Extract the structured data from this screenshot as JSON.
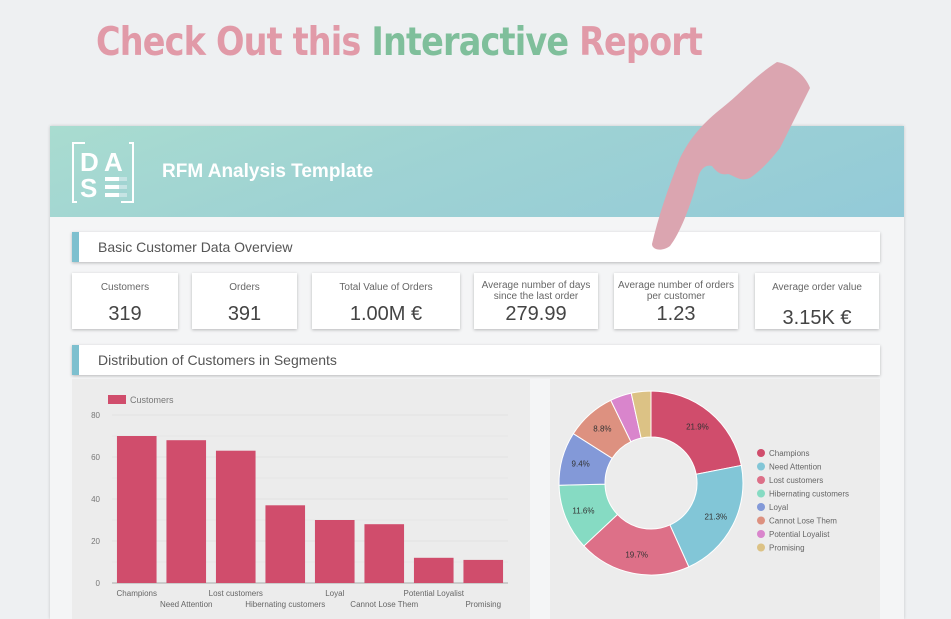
{
  "promo": {
    "part1": "Check Out this ",
    "part2": "Interactive",
    "part3": " Report",
    "pink": "#e19aa8",
    "green": "#7fbf9b"
  },
  "report": {
    "logo_letters": [
      "D",
      "A",
      "S",
      "E"
    ],
    "title": "RFM Analysis Template",
    "section1": "Basic Customer Data Overview",
    "section2": "Distribution of Customers in Segments"
  },
  "kpis": [
    {
      "label": "Customers",
      "value": "319"
    },
    {
      "label": "Orders",
      "value": "391"
    },
    {
      "label": "Total Value of Orders",
      "value": "1.00M €"
    },
    {
      "label": "Average number of days since the last order",
      "label_lines": [
        "Average number of days",
        "since the last order"
      ],
      "value": "279.99"
    },
    {
      "label": "Average number of orders per customer",
      "label_lines": [
        "Average number of orders",
        "per customer"
      ],
      "value": "1.23"
    },
    {
      "label": "Average order value",
      "value": "3.15K €"
    }
  ],
  "chart_data": [
    {
      "type": "bar",
      "title": "",
      "legend": [
        "Customers"
      ],
      "legend_position": "top-left",
      "categories": [
        "Champions",
        "Need Attention",
        "Lost customers",
        "Hibernating customers",
        "Loyal",
        "Cannot Lose Them",
        "Potential Loyalist",
        "Promising"
      ],
      "values": [
        70,
        68,
        63,
        37,
        30,
        28,
        12,
        11
      ],
      "ylim": [
        0,
        80
      ],
      "yticks": [
        0,
        20,
        40,
        60,
        80
      ],
      "color": "#d04d6c",
      "grid": true,
      "xlabel": "",
      "ylabel": ""
    },
    {
      "type": "pie",
      "donut": true,
      "legend_position": "right",
      "categories": [
        "Champions",
        "Need Attention",
        "Lost customers",
        "Hibernating customers",
        "Loyal",
        "Cannot Lose Them",
        "Potential Loyalist",
        "Promising"
      ],
      "values": [
        70,
        68,
        63,
        37,
        30,
        28,
        12,
        11
      ],
      "percent_labels": [
        "21.9%",
        "21.3%",
        "19.7%",
        "11.6%",
        "9.4%",
        "8.8%",
        "",
        ""
      ],
      "colors": [
        "#d04d6c",
        "#82c6d7",
        "#dd7088",
        "#86dbc3",
        "#8399d8",
        "#dd9180",
        "#d985cc",
        "#dcc285"
      ]
    }
  ]
}
